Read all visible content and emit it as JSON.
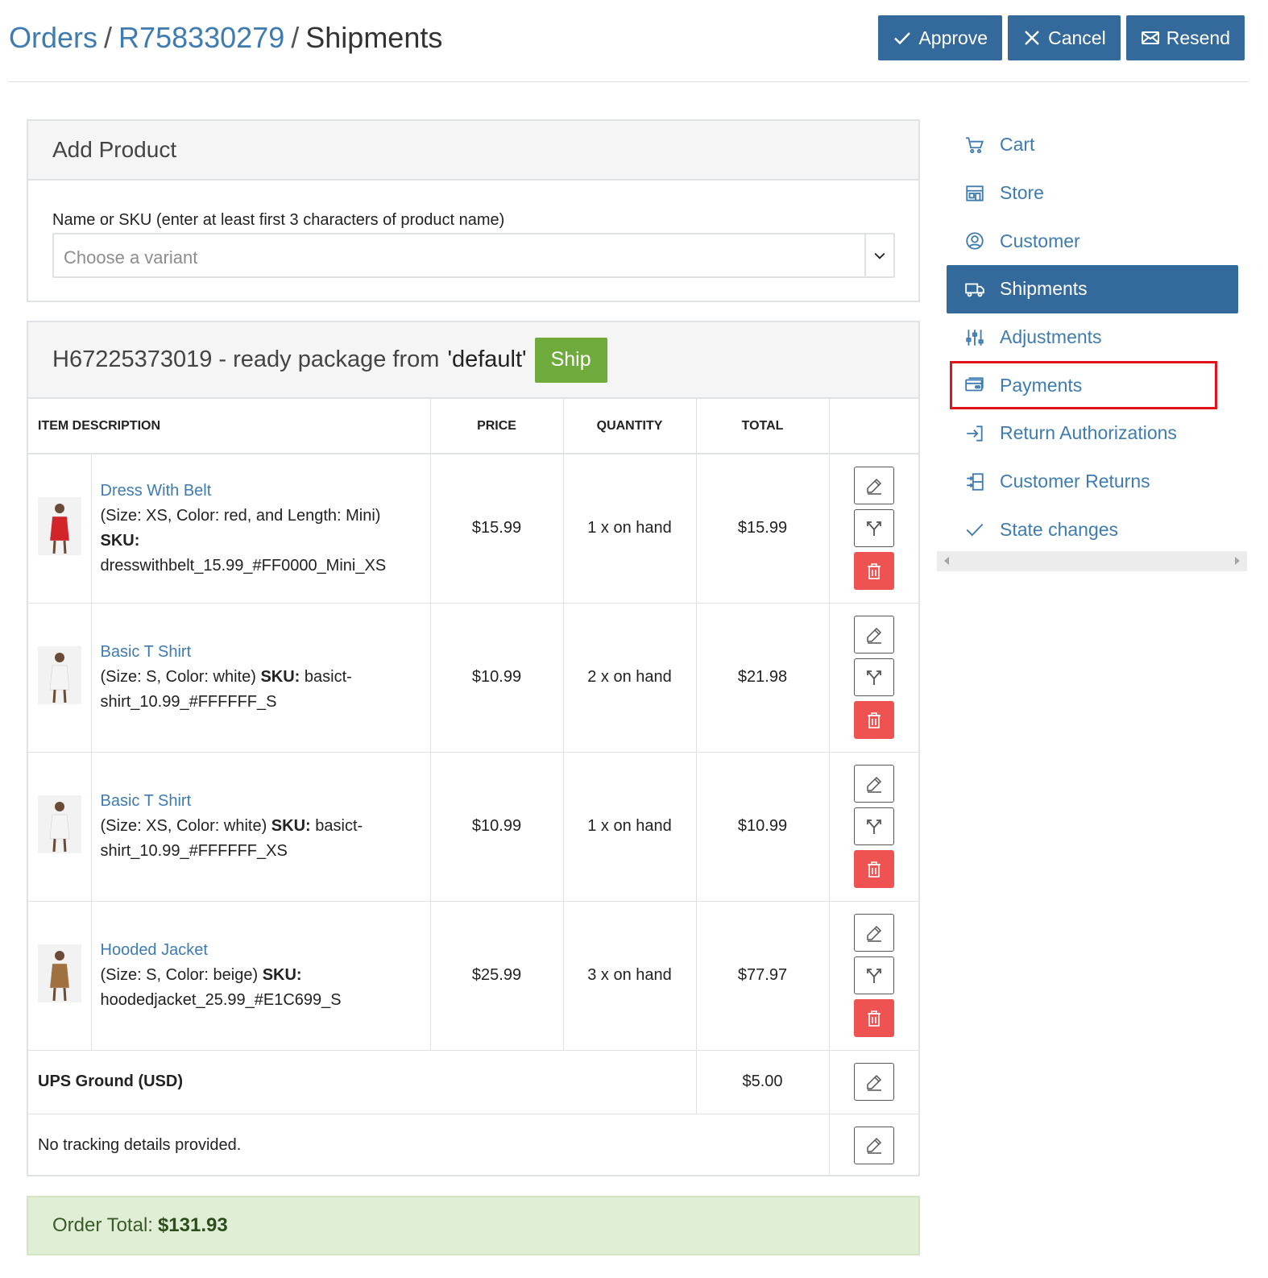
{
  "header": {
    "breadcrumb": [
      {
        "label": "Orders",
        "link": true
      },
      {
        "label": "R758330279",
        "link": true
      },
      {
        "label": "Shipments",
        "link": false
      }
    ],
    "separator": "/",
    "buttons": [
      {
        "label": "Approve",
        "icon": "check-icon"
      },
      {
        "label": "Cancel",
        "icon": "close-icon"
      },
      {
        "label": "Resend",
        "icon": "envelope-icon"
      }
    ]
  },
  "add_product": {
    "title": "Add Product",
    "field_label": "Name or SKU (enter at least first 3 characters of product name)",
    "placeholder": "Choose a variant"
  },
  "shipment": {
    "number": "H67225373019",
    "state_text": "- ready package from",
    "stock_location": "'default'",
    "ship_label": "Ship",
    "columns": [
      "Item Description",
      "Price",
      "Quantity",
      "Total"
    ],
    "items": [
      {
        "name": "Dress With Belt",
        "options": "(Size: XS, Color: red, and Length: Mini)",
        "sku_label": "SKU:",
        "sku": "dresswithbelt_15.99_#FF0000_Mini_XS",
        "price": "$15.99",
        "quantity": "1 x on hand",
        "total": "$15.99",
        "thumb_color": "#d3242a"
      },
      {
        "name": "Basic T Shirt",
        "options": "(Size: S, Color: white)",
        "sku_label": "SKU:",
        "sku": "basict-shirt_10.99_#FFFFFF_S",
        "price": "$10.99",
        "quantity": "2 x on hand",
        "total": "$21.98",
        "thumb_color": "#f4f4f4"
      },
      {
        "name": "Basic T Shirt",
        "options": "(Size: XS, Color: white)",
        "sku_label": "SKU:",
        "sku": "basict-shirt_10.99_#FFFFFF_XS",
        "price": "$10.99",
        "quantity": "1 x on hand",
        "total": "$10.99",
        "thumb_color": "#f4f4f4"
      },
      {
        "name": "Hooded Jacket",
        "options": "(Size: S, Color: beige)",
        "sku_label": "SKU:",
        "sku": "hoodedjacket_25.99_#E1C699_S",
        "price": "$25.99",
        "quantity": "3 x on hand",
        "total": "$77.97",
        "thumb_color": "#a0703e"
      }
    ],
    "shipping_method": "UPS Ground (USD)",
    "shipping_cost": "$5.00",
    "tracking": "No tracking details provided."
  },
  "order_total": {
    "label": "Order Total:",
    "value": "$131.93"
  },
  "sidebar": {
    "items": [
      {
        "label": "Cart",
        "icon": "cart-icon",
        "active": false
      },
      {
        "label": "Store",
        "icon": "store-icon",
        "active": false
      },
      {
        "label": "Customer",
        "icon": "user-circle-icon",
        "active": false
      },
      {
        "label": "Shipments",
        "icon": "truck-icon",
        "active": true
      },
      {
        "label": "Adjustments",
        "icon": "sliders-icon",
        "active": false
      },
      {
        "label": "Payments",
        "icon": "credit-card-icon",
        "active": false,
        "highlighted": true
      },
      {
        "label": "Return Authorizations",
        "icon": "return-icon",
        "active": false
      },
      {
        "label": "Customer Returns",
        "icon": "customer-returns-icon",
        "active": false
      },
      {
        "label": "State changes",
        "icon": "check-icon",
        "active": false
      }
    ]
  },
  "colors": {
    "primary": "#34699b",
    "link": "#3e7bb0",
    "success": "#6fab3c",
    "danger": "#ee5251",
    "total_bg": "#e1eed6",
    "highlight": "#e0141a"
  }
}
